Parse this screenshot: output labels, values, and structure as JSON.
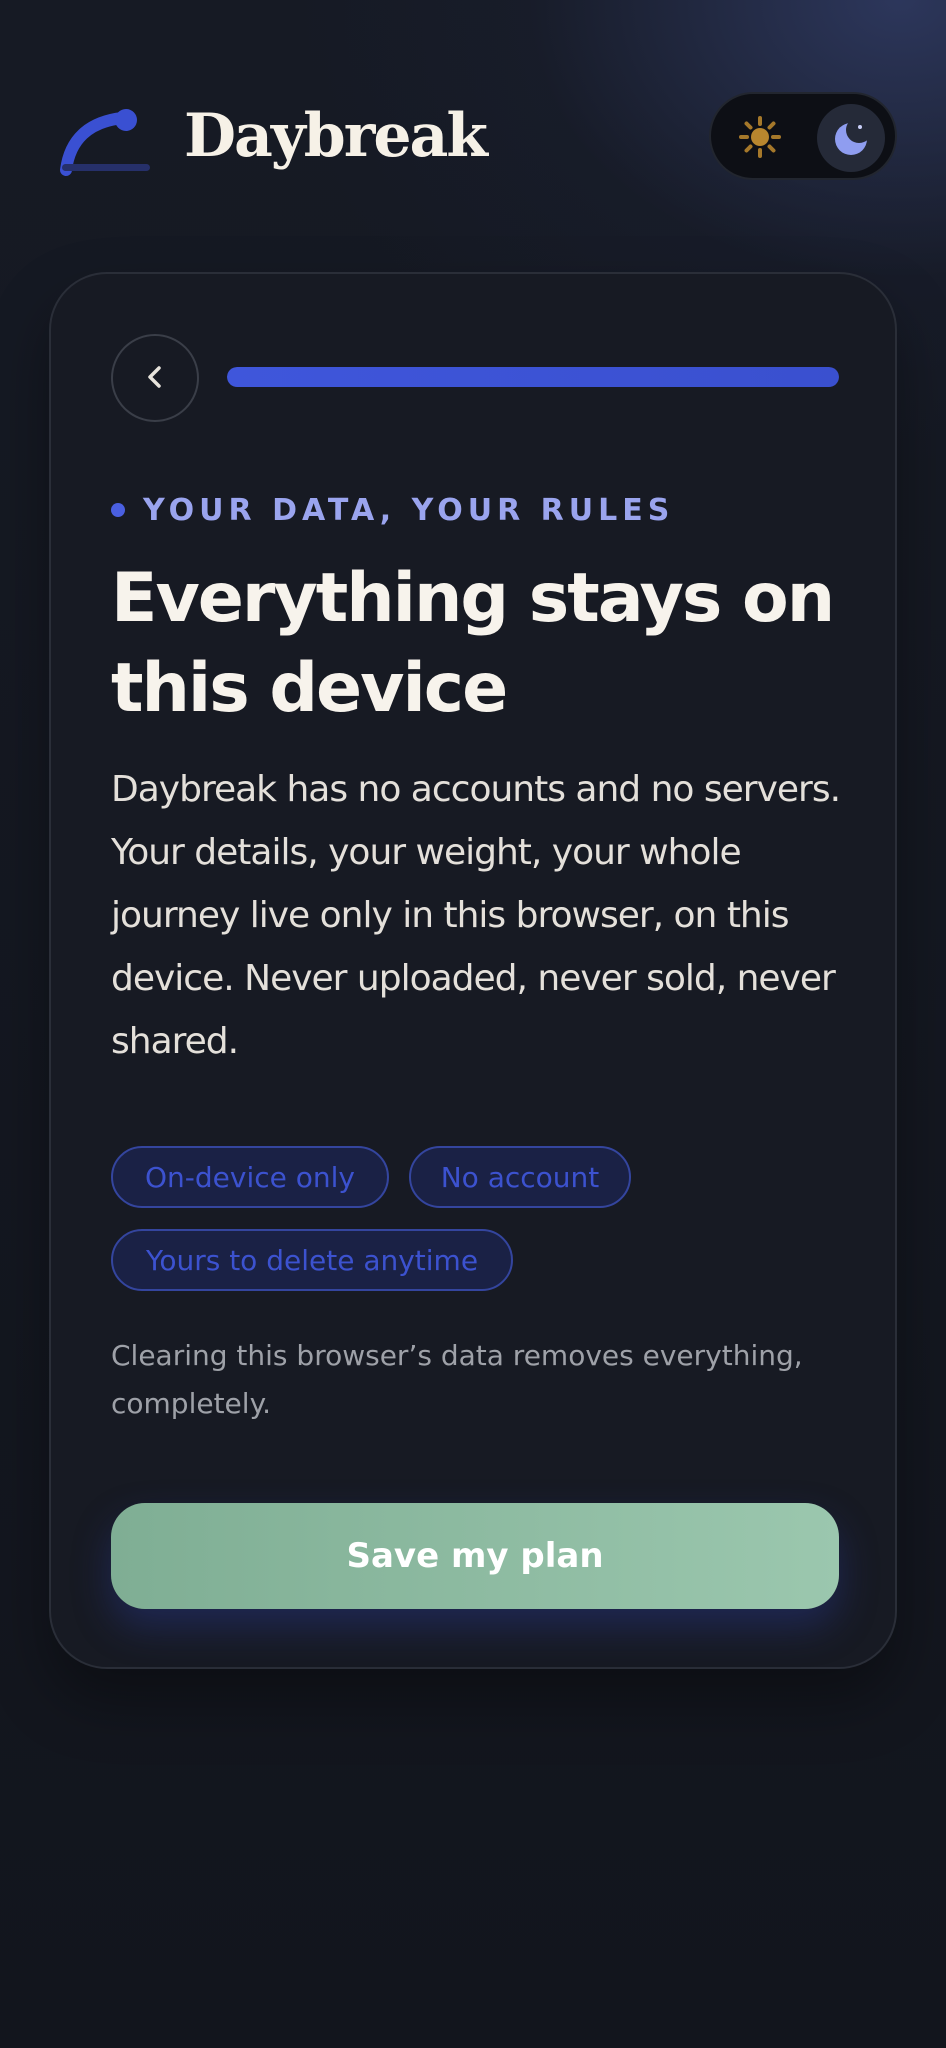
{
  "header": {
    "brand": "Daybreak",
    "logo_icon": "sunrise-arc-icon",
    "theme_toggle": {
      "options": [
        "light",
        "dark"
      ],
      "selected": "dark",
      "light_icon": "sun-icon",
      "dark_icon": "moon-icon"
    }
  },
  "onboarding": {
    "back_icon": "chevron-left-icon",
    "progress": 1.0,
    "eyebrow": "YOUR DATA, YOUR RULES",
    "title": "Everything stays on this device",
    "description": "Daybreak has no accounts and no servers. Your details, your weight, your whole journey live only in this browser, on this device. Never uploaded, never sold, never shared.",
    "chips": [
      "On-device only",
      "No account",
      "Yours to delete anytime"
    ],
    "note": "Clearing this browser’s data removes everything, completely.",
    "save_label": "Save my plan"
  },
  "colors": {
    "background": "#12151d",
    "card": "#171a23",
    "accent": "#3f56db",
    "eyebrow": "#9aa4ee",
    "button": "#8ebba1"
  }
}
